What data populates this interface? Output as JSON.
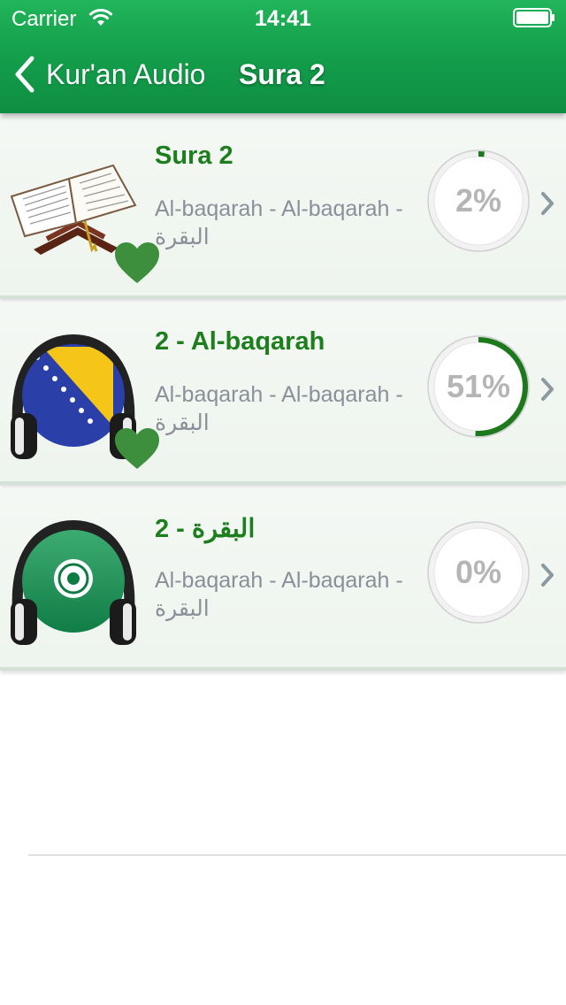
{
  "status_bar": {
    "carrier": "Carrier",
    "time": "14:41"
  },
  "nav": {
    "back_label": "Kur'an Audio",
    "title": "Sura 2"
  },
  "colors": {
    "header_green": "#14a04c",
    "title_green": "#1d7e1d",
    "heart_green": "#3d8f3d",
    "progress_green": "#1c7a1c"
  },
  "rows": [
    {
      "title": "Sura 2",
      "subtitle": "Al-baqarah - Al-baqarah - البقرة",
      "thumbnail": "quran-book-icon",
      "favorite": true,
      "progress_label": "2%",
      "progress": 0.02
    },
    {
      "title": "2 - Al-baqarah",
      "subtitle": "Al-baqarah - Al-baqarah - البقرة",
      "thumbnail": "bosnia-flag-headphones-icon",
      "favorite": true,
      "progress_label": "51%",
      "progress": 0.51
    },
    {
      "title": "2 - البقرة",
      "subtitle": "Al-baqarah - Al-baqarah - البقرة",
      "thumbnail": "arab-league-flag-headphones-icon",
      "favorite": false,
      "progress_label": "0%",
      "progress": 0.0
    }
  ]
}
